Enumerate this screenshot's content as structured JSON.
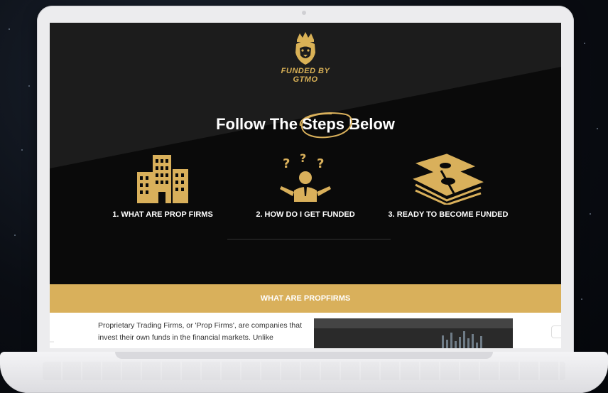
{
  "site": {
    "brand": "FUNDED BY GTMO",
    "headline": {
      "part1": "Follow The",
      "highlight": "Steps",
      "part2": "Below"
    },
    "steps": [
      {
        "label": "1. WHAT ARE PROP FIRMS",
        "icon": "buildings-icon"
      },
      {
        "label": "2. HOW DO I GET FUNDED",
        "icon": "confused-person-icon"
      },
      {
        "label": "3. READY TO BECOME FUNDED",
        "icon": "money-stack-icon"
      }
    ],
    "section_title": "WHAT ARE PROPFIRMS",
    "paragraph_lines": [
      "Proprietary Trading Firms, or 'Prop Firms', are companies that",
      "invest their own funds in the financial markets. Unlike"
    ]
  },
  "colors": {
    "gold": "#d9b05b",
    "hero_dark": "#0a0a0a",
    "hero_light": "#1c1c1c"
  }
}
